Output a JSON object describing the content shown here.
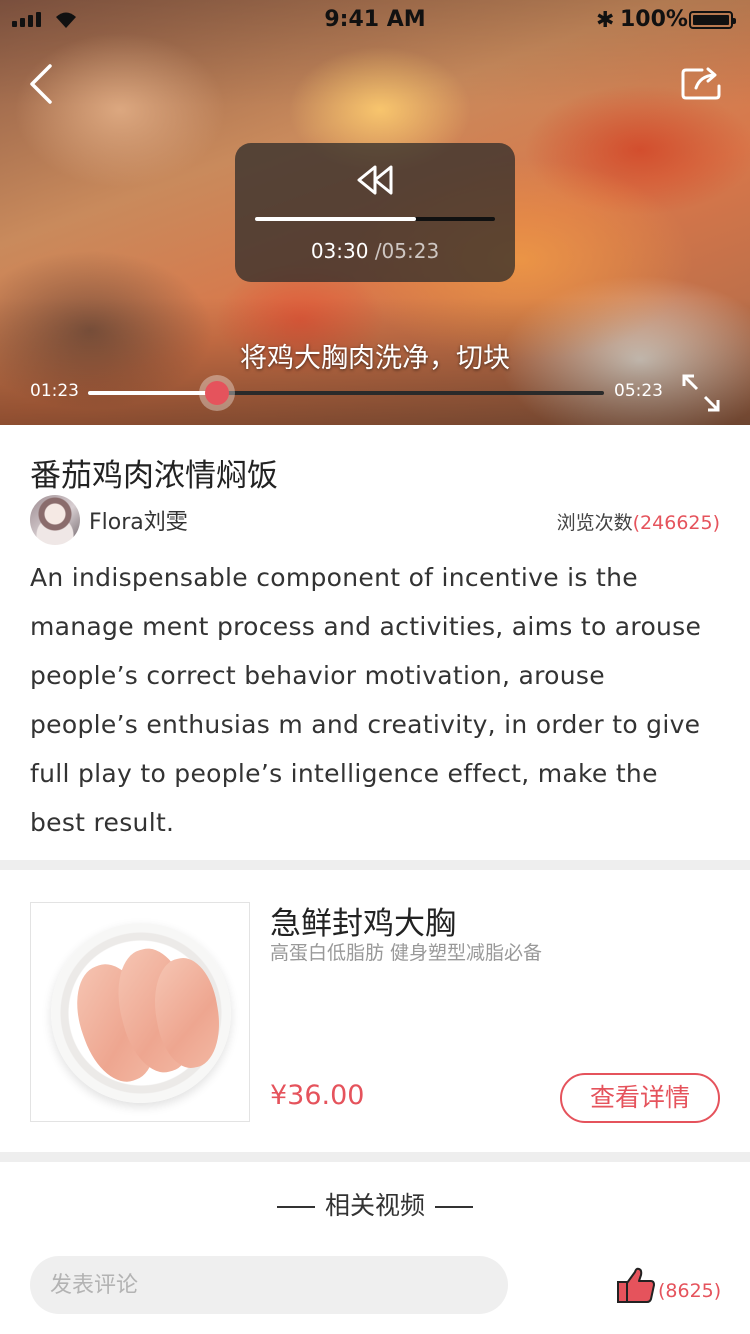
{
  "status_bar": {
    "time": "9:41 AM",
    "battery": "100%",
    "icons": [
      "signal-icon",
      "wifi-icon",
      "bluetooth-icon",
      "battery-icon"
    ]
  },
  "player": {
    "back_icon": "chevron-left-icon",
    "share_icon": "share-icon",
    "seek_popup": {
      "icon": "rewind-icon",
      "time": "03:30",
      "total": "/05:23",
      "progress": 0.67
    },
    "subtitle": "将鸡大胸肉洗净，切块",
    "current_time": "01:23",
    "duration": "05:23",
    "progress": 0.25,
    "fullscreen_icon": "fullscreen-icon"
  },
  "recipe": {
    "title": "番茄鸡肉浓情焖饭",
    "author": "Flora刘雯",
    "views_label": "浏览次数",
    "views_count": "(246625)",
    "description": "An indispensable component of incentive is the manage ment process and activities, aims to arouse people’s correct behavior motivation, arouse people’s enthusias m and creativity, in order to give full play to people’s intelligence effect, make the best result."
  },
  "product": {
    "name": "急鲜封鸡大胸",
    "subtitle": "高蛋白低脂肪 健身塑型减脂必备",
    "price": "¥36.00",
    "detail_button": "查看详情"
  },
  "related": {
    "title": "相关视频"
  },
  "comment": {
    "placeholder": "发表评论",
    "like_icon": "thumbs-up-icon",
    "like_count": "(8625)"
  },
  "colors": {
    "accent": "#e5535c",
    "divider": "#eeeeee",
    "input_bg": "#efefef"
  }
}
